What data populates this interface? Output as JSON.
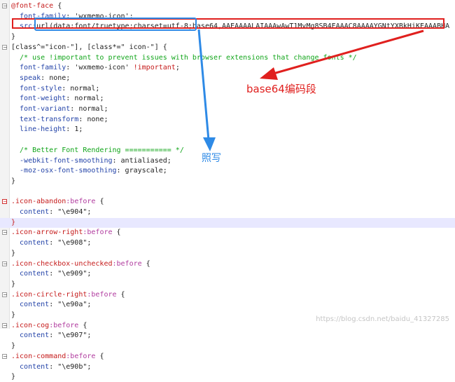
{
  "editor": {
    "lines": [
      {
        "fold": "minus",
        "parts": [
          [
            "k",
            "@font-face"
          ],
          [
            "br",
            " {"
          ]
        ]
      },
      {
        "parts": [
          [
            "pr",
            "  font-family"
          ],
          [
            "str",
            ": 'wxmemo-icon';"
          ]
        ]
      },
      {
        "parts": [
          [
            "pr",
            "  src"
          ],
          [
            "str",
            ":url(data:font/truetype;charset=utf-8;base64,AAEAAAALAIAAAwAwT1MvMg8SB4EAAAC8AAAAYGNtYXBkHiKEAAABHA"
          ]
        ]
      },
      {
        "parts": [
          [
            "br",
            "}"
          ]
        ]
      },
      {
        "fold": "minus",
        "parts": [
          [
            "str",
            "[class^=\"icon-\"], [class*=\" icon-\"] {"
          ]
        ]
      },
      {
        "parts": [
          [
            "cm",
            "  /* use !important to prevent issues with browser extensions that change fonts */"
          ]
        ]
      },
      {
        "parts": [
          [
            "pr",
            "  font-family"
          ],
          [
            "str",
            ": 'wxmemo-icon' "
          ],
          [
            "k",
            "!important"
          ],
          [
            "str",
            ";"
          ]
        ]
      },
      {
        "parts": [
          [
            "pr",
            "  speak"
          ],
          [
            "str",
            ": none;"
          ]
        ]
      },
      {
        "parts": [
          [
            "pr",
            "  font-style"
          ],
          [
            "str",
            ": normal;"
          ]
        ]
      },
      {
        "parts": [
          [
            "pr",
            "  font-weight"
          ],
          [
            "str",
            ": normal;"
          ]
        ]
      },
      {
        "parts": [
          [
            "pr",
            "  font-variant"
          ],
          [
            "str",
            ": normal;"
          ]
        ]
      },
      {
        "parts": [
          [
            "pr",
            "  text-transform"
          ],
          [
            "str",
            ": none;"
          ]
        ]
      },
      {
        "parts": [
          [
            "pr",
            "  line-height"
          ],
          [
            "str",
            ": 1;"
          ]
        ]
      },
      {
        "parts": [
          [
            "str",
            ""
          ]
        ]
      },
      {
        "parts": [
          [
            "cm",
            "  /* Better Font Rendering =========== */"
          ]
        ]
      },
      {
        "parts": [
          [
            "pr",
            "  -webkit-font-smoothing"
          ],
          [
            "str",
            ": antialiased;"
          ]
        ]
      },
      {
        "parts": [
          [
            "pr",
            "  -moz-osx-font-smoothing"
          ],
          [
            "str",
            ": grayscale;"
          ]
        ]
      },
      {
        "parts": [
          [
            "br",
            "}"
          ]
        ]
      },
      {
        "parts": [
          [
            "str",
            ""
          ]
        ]
      },
      {
        "fold": "minus-red",
        "parts": [
          [
            "sel",
            ".icon-abandon"
          ],
          [
            "kw",
            ":before"
          ],
          [
            "br",
            " {"
          ]
        ]
      },
      {
        "parts": [
          [
            "pr",
            "  content"
          ],
          [
            "str",
            ": \"\\e904\";"
          ]
        ]
      },
      {
        "hl": true,
        "parts": [
          [
            "k",
            "}"
          ]
        ]
      },
      {
        "fold": "minus",
        "parts": [
          [
            "sel",
            ".icon-arrow-right"
          ],
          [
            "kw",
            ":before"
          ],
          [
            "br",
            " {"
          ]
        ]
      },
      {
        "parts": [
          [
            "pr",
            "  content"
          ],
          [
            "str",
            ": \"\\e908\";"
          ]
        ]
      },
      {
        "parts": [
          [
            "br",
            "}"
          ]
        ]
      },
      {
        "fold": "minus",
        "parts": [
          [
            "sel",
            ".icon-checkbox-unchecked"
          ],
          [
            "kw",
            ":before"
          ],
          [
            "br",
            " {"
          ]
        ]
      },
      {
        "parts": [
          [
            "pr",
            "  content"
          ],
          [
            "str",
            ": \"\\e909\";"
          ]
        ]
      },
      {
        "parts": [
          [
            "br",
            "}"
          ]
        ]
      },
      {
        "fold": "minus",
        "parts": [
          [
            "sel",
            ".icon-circle-right"
          ],
          [
            "kw",
            ":before"
          ],
          [
            "br",
            " {"
          ]
        ]
      },
      {
        "parts": [
          [
            "pr",
            "  content"
          ],
          [
            "str",
            ": \"\\e90a\";"
          ]
        ]
      },
      {
        "parts": [
          [
            "br",
            "}"
          ]
        ]
      },
      {
        "fold": "minus",
        "parts": [
          [
            "sel",
            ".icon-cog"
          ],
          [
            "kw",
            ":before"
          ],
          [
            "br",
            " {"
          ]
        ]
      },
      {
        "parts": [
          [
            "pr",
            "  content"
          ],
          [
            "str",
            ": \"\\e907\";"
          ]
        ]
      },
      {
        "parts": [
          [
            "br",
            "}"
          ]
        ]
      },
      {
        "fold": "minus",
        "parts": [
          [
            "sel",
            ".icon-command"
          ],
          [
            "kw",
            ":before"
          ],
          [
            "br",
            " {"
          ]
        ]
      },
      {
        "parts": [
          [
            "pr",
            "  content"
          ],
          [
            "str",
            ": \"\\e90b\";"
          ]
        ]
      },
      {
        "parts": [
          [
            "br",
            "}"
          ]
        ]
      }
    ]
  },
  "annotations": {
    "red_label": "base64编码段",
    "blue_label": "照写"
  },
  "watermark": "https://blog.csdn.net/baidu_41327285",
  "colors": {
    "red": "#e0201e",
    "blue": "#2e8ae6",
    "comment": "#11a51a",
    "property": "#2343a8",
    "selector": "#c51a1a",
    "pseudo": "#b03a9e"
  }
}
